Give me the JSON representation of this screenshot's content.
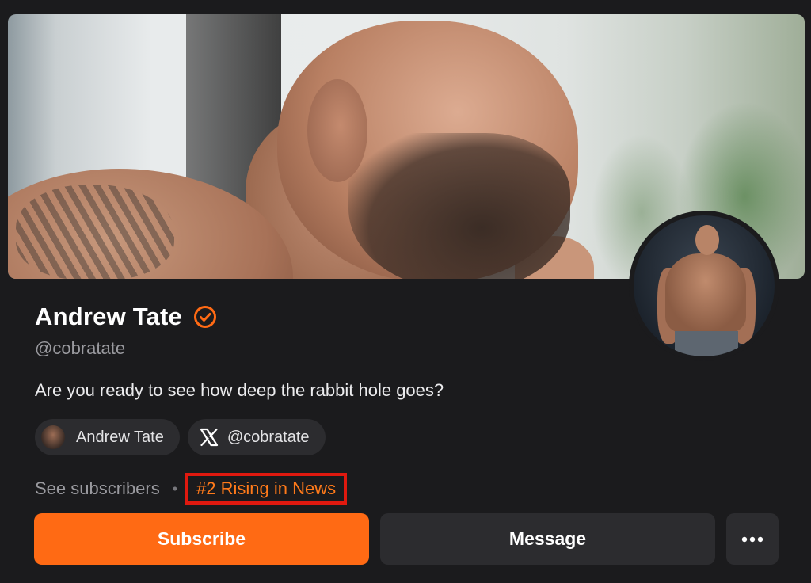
{
  "profile": {
    "name": "Andrew Tate",
    "handle": "@cobratate",
    "bio": "Are you ready to see how deep the rabbit hole goes?",
    "verified_icon": "verified-check-icon"
  },
  "links": [
    {
      "label": "Andrew Tate",
      "icon": "profile-avatar-icon"
    },
    {
      "label": "@cobratate",
      "icon": "x-logo-icon"
    }
  ],
  "meta": {
    "see_subscribers": "See subscribers",
    "separator": "•",
    "rank": "#2 Rising in News"
  },
  "actions": {
    "subscribe": "Subscribe",
    "message": "Message",
    "more_icon": "more-horizontal-icon"
  },
  "colors": {
    "accent": "#ff6a14",
    "highlight_box": "#e0190f",
    "background": "#1b1b1d",
    "button_secondary": "#2c2c2f"
  }
}
